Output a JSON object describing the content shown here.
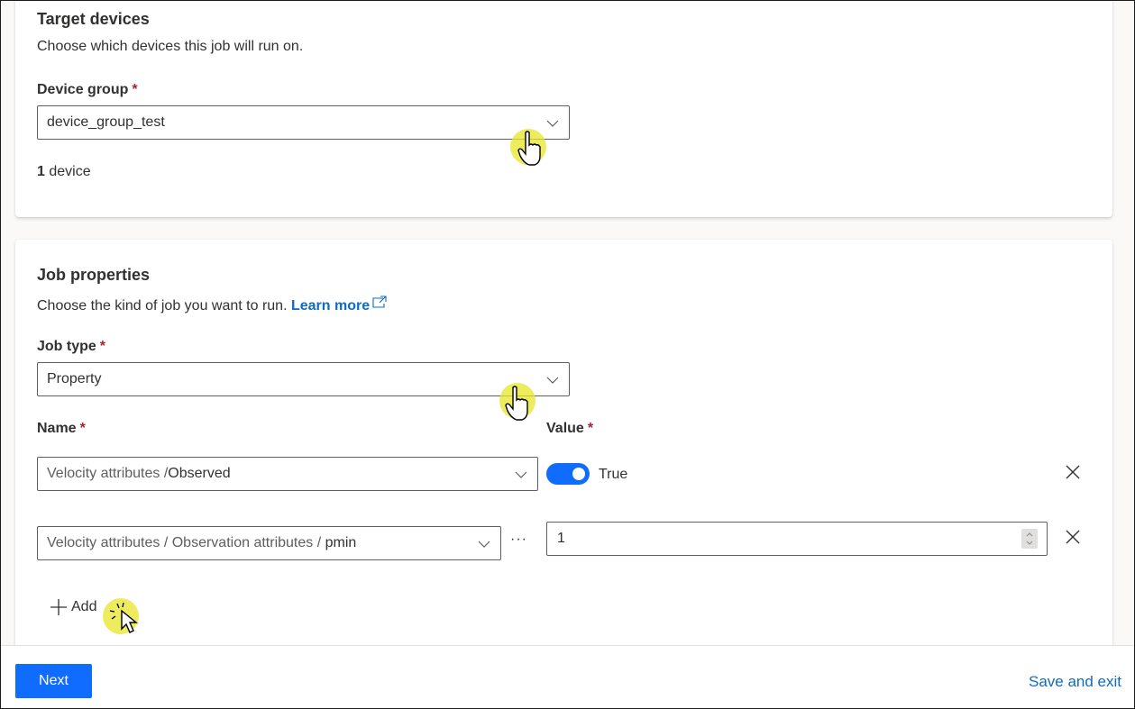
{
  "target_devices": {
    "title": "Target devices",
    "description": "Choose which devices this job will run on.",
    "device_group_label": "Device group",
    "required_marker": "*",
    "device_group_value": "device_group_test",
    "device_count": "1",
    "device_count_suffix": " device"
  },
  "job_properties": {
    "title": "Job properties",
    "description": "Choose the kind of job you want to run.",
    "learn_more": "Learn more",
    "job_type_label": "Job type",
    "job_type_value": "Property",
    "name_label": "Name",
    "value_label": "Value",
    "rows": [
      {
        "name_path": "Velocity attributes / ",
        "name_leaf": "Observed",
        "value_type": "toggle",
        "toggle_on": true,
        "toggle_label": "True"
      },
      {
        "name_path": "Velocity attributes / Observation attributes / ",
        "name_leaf": "pmin",
        "value_type": "number",
        "value": "1"
      }
    ],
    "more_label": "···",
    "add_label": "Add"
  },
  "footer": {
    "next_label": "Next",
    "save_exit_label": "Save and exit"
  },
  "colors": {
    "accent": "#0f6cfe",
    "link": "#0f6cbd",
    "required": "#a4262c"
  }
}
